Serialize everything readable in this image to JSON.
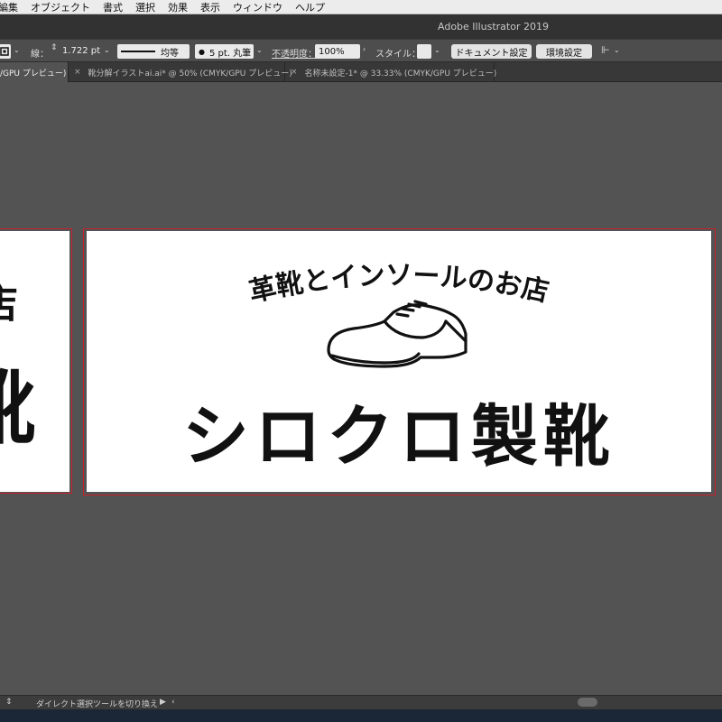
{
  "menubar": {
    "items": [
      "編集",
      "オブジェクト",
      "書式",
      "選択",
      "効果",
      "表示",
      "ウィンドウ",
      "ヘルプ"
    ]
  },
  "window": {
    "title": "Adobe Illustrator 2019"
  },
  "controlbar": {
    "stroke_label": "線：",
    "stroke_weight": "1.722 pt",
    "profile_label": "均等",
    "brush_label": "5 pt. 丸筆",
    "opacity_label": "不透明度：",
    "opacity_value": "100%",
    "style_label": "スタイル：",
    "doc_settings_button": "ドキュメント設定",
    "preferences_button": "環境設定"
  },
  "tabs": [
    {
      "label": "/GPU プレビュー)",
      "active": true
    },
    {
      "label": "靴分解イラストai.ai* @ 50% (CMYK/GPU プレビュー)",
      "active": false
    },
    {
      "label": "名称未設定-1* @ 33.33% (CMYK/GPU プレビュー)",
      "active": false
    }
  ],
  "artboard_main": {
    "subtitle": "革靴とインソールのお店",
    "title": "シロクロ製靴"
  },
  "artboard_left": {
    "top_glyph": "店",
    "big_glyph": "靴"
  },
  "statusbar": {
    "text": "ダイレクト選択ツールを切り換え"
  },
  "colors": {
    "selection": "#c8202a",
    "canvas": "#535353",
    "ui_dark": "#323232"
  }
}
